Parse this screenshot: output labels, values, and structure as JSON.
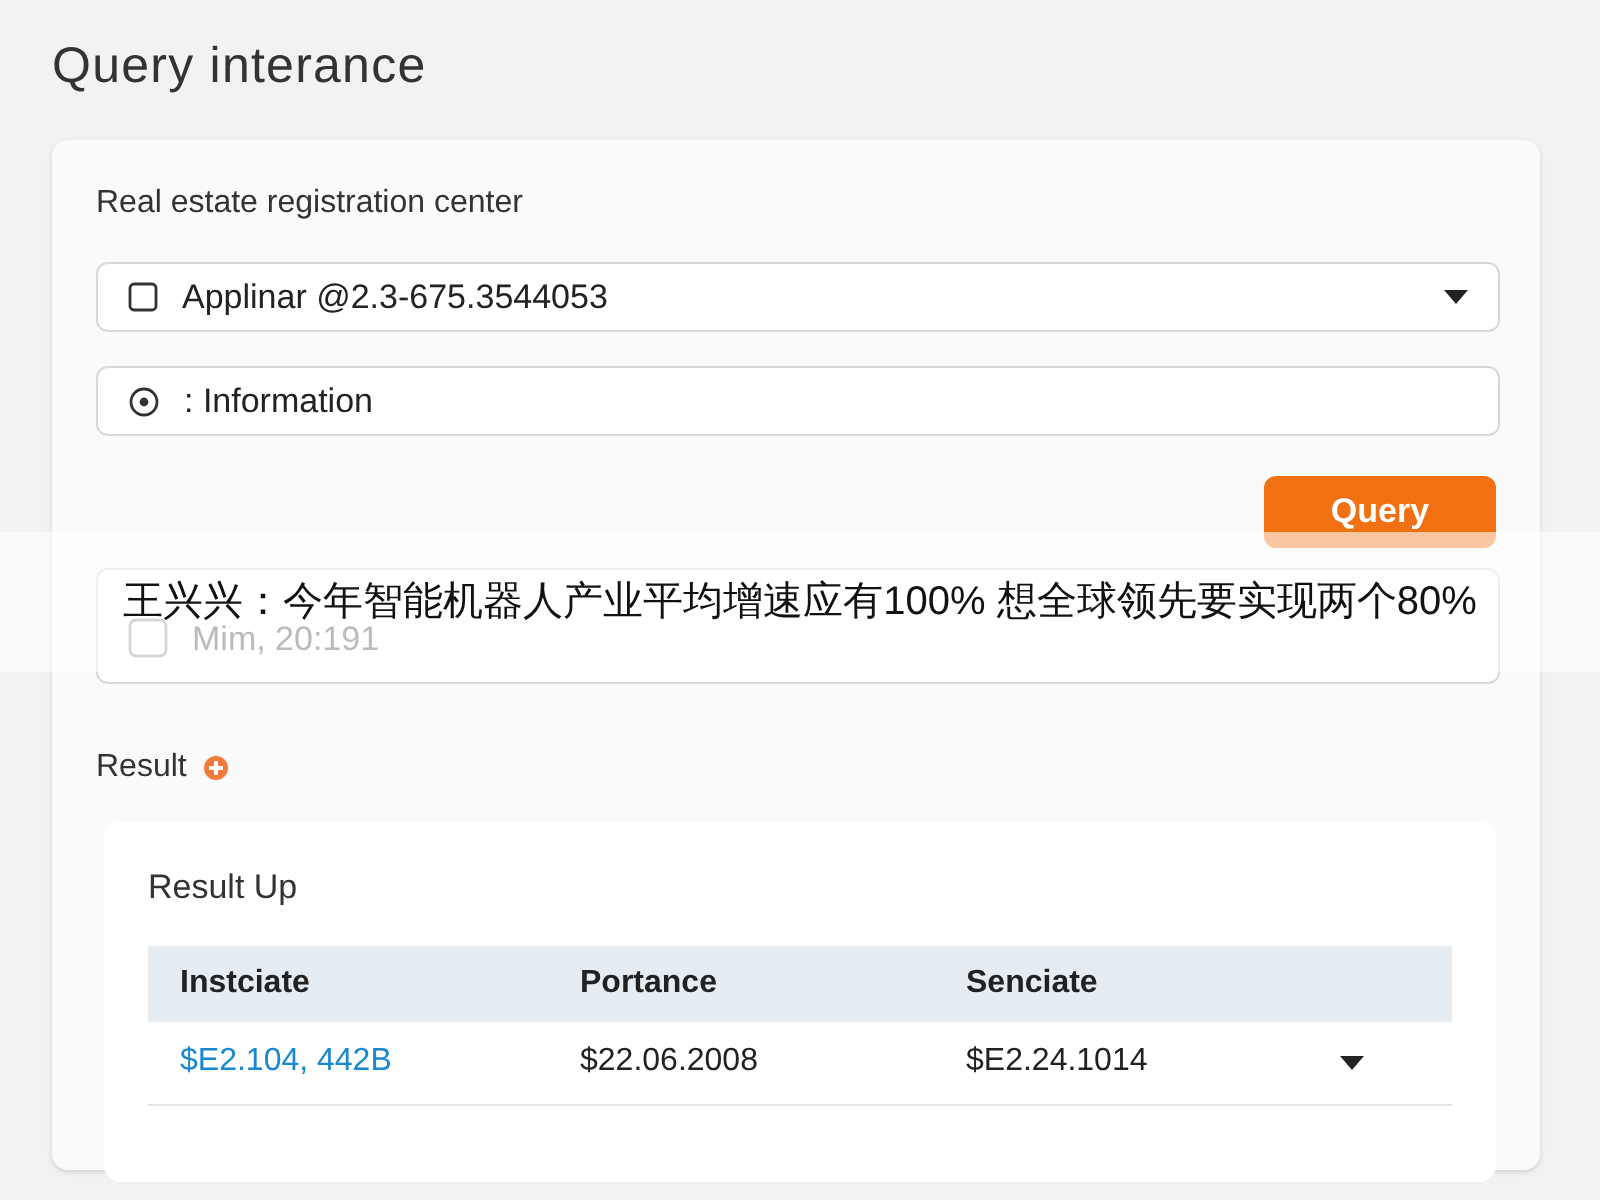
{
  "page": {
    "title": "Query interance"
  },
  "form": {
    "heading": "Real estate registration center",
    "fields": [
      {
        "kind": "select",
        "value": "Applinar @2.3-675.3544053"
      },
      {
        "kind": "text",
        "value": ": Information"
      },
      {
        "kind": "date",
        "value": "Mim, 20:191"
      }
    ],
    "button": "Query"
  },
  "result": {
    "label": "Result",
    "card_title": "Result Up",
    "table": {
      "columns": [
        "Instciate",
        "Portance",
        "Senciate"
      ],
      "rows": [
        {
          "cells": [
            "$E2.104, 442B",
            "$22.06.2008",
            "$E2.24.1014"
          ],
          "expanded": false
        }
      ]
    }
  },
  "banner": {
    "text": "王兴兴：今年智能机器人产业平均增速应有100% 想全球领先要实现两个80%"
  }
}
